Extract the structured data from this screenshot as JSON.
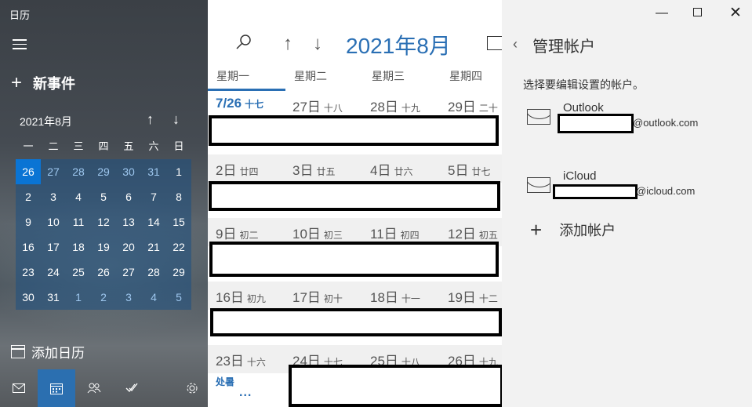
{
  "app": {
    "title": "日历"
  },
  "sidebar": {
    "new_event": "新事件",
    "mini_month": "2021年8月",
    "weekdays": [
      "一",
      "二",
      "三",
      "四",
      "五",
      "六",
      "日"
    ],
    "grid": [
      [
        "26",
        "27",
        "28",
        "29",
        "30",
        "31",
        "1"
      ],
      [
        "2",
        "3",
        "4",
        "5",
        "6",
        "7",
        "8"
      ],
      [
        "9",
        "10",
        "11",
        "12",
        "13",
        "14",
        "15"
      ],
      [
        "16",
        "17",
        "18",
        "19",
        "20",
        "21",
        "22"
      ],
      [
        "23",
        "24",
        "25",
        "26",
        "27",
        "28",
        "29"
      ],
      [
        "30",
        "31",
        "1",
        "2",
        "3",
        "4",
        "5"
      ]
    ],
    "add_calendar": "添加日历",
    "bottom_icons": [
      "mail-icon",
      "calendar-icon",
      "people-icon",
      "todo-icon",
      "settings-icon"
    ]
  },
  "calendar": {
    "month_title": "2021年8月",
    "dow": [
      "星期一",
      "星期二",
      "星期三",
      "星期四"
    ],
    "weeks": [
      {
        "days": [
          {
            "d": "7/26",
            "l": "十七"
          },
          {
            "d": "27日",
            "l": "十八"
          },
          {
            "d": "28日",
            "l": "十九"
          },
          {
            "d": "29日",
            "l": "二十"
          }
        ]
      },
      {
        "days": [
          {
            "d": "2日",
            "l": "廿四"
          },
          {
            "d": "3日",
            "l": "廿五"
          },
          {
            "d": "4日",
            "l": "廿六"
          },
          {
            "d": "5日",
            "l": "廿七"
          }
        ]
      },
      {
        "days": [
          {
            "d": "9日",
            "l": "初二"
          },
          {
            "d": "10日",
            "l": "初三"
          },
          {
            "d": "11日",
            "l": "初四"
          },
          {
            "d": "12日",
            "l": "初五"
          }
        ]
      },
      {
        "days": [
          {
            "d": "16日",
            "l": "初九"
          },
          {
            "d": "17日",
            "l": "初十"
          },
          {
            "d": "18日",
            "l": "十一"
          },
          {
            "d": "19日",
            "l": "十二"
          }
        ]
      },
      {
        "days": [
          {
            "d": "23日",
            "l": "十六"
          },
          {
            "d": "24日",
            "l": "十七"
          },
          {
            "d": "25日",
            "l": "十八"
          },
          {
            "d": "26日",
            "l": "十九"
          }
        ]
      }
    ],
    "event_label": "处暑",
    "more": "..."
  },
  "panel": {
    "title": "管理帐户",
    "subtitle": "选择要编辑设置的帐户。",
    "accounts": [
      {
        "name": "Outlook",
        "domain": "@outlook.com"
      },
      {
        "name": "iCloud",
        "domain": "@icloud.com"
      }
    ],
    "add_account": "添加帐户"
  },
  "colors": {
    "accent": "#2a6fb4",
    "today": "#0a74d4"
  }
}
